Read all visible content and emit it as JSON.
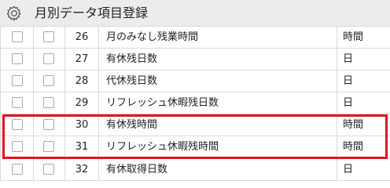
{
  "header": {
    "title": "月別データ項目登録",
    "icon": "gear-icon"
  },
  "rows": [
    {
      "no": "26",
      "name": "月のみなし残業時間",
      "unit": "時間"
    },
    {
      "no": "27",
      "name": "有休残日数",
      "unit": "日"
    },
    {
      "no": "28",
      "name": "代休残日数",
      "unit": "日"
    },
    {
      "no": "29",
      "name": "リフレッシュ休暇残日数",
      "unit": "日"
    },
    {
      "no": "30",
      "name": "有休残時間",
      "unit": "時間"
    },
    {
      "no": "31",
      "name": "リフレッシュ休暇残時間",
      "unit": "時間"
    },
    {
      "no": "32",
      "name": "有休取得日数",
      "unit": "日"
    }
  ],
  "colors": {
    "header_bg": "#ececec",
    "highlight": "#e3141e",
    "grid": "#d9d9d9"
  }
}
